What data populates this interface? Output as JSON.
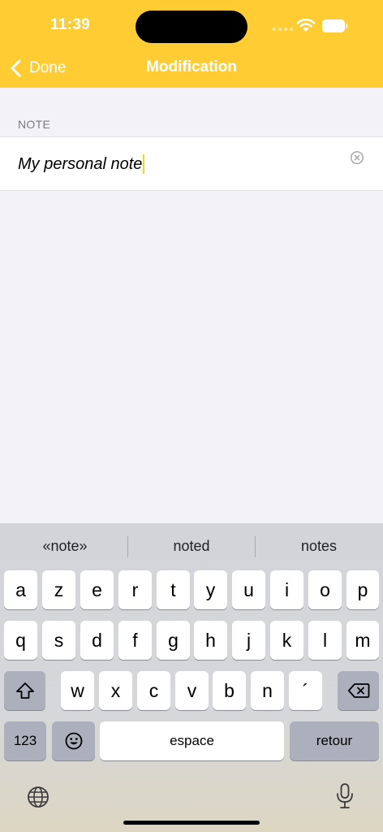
{
  "status": {
    "time": "11:39"
  },
  "nav": {
    "back_label": "Done",
    "title": "Modification"
  },
  "form": {
    "section_label": "NOTE",
    "value": "My personal note"
  },
  "keyboard": {
    "suggestions": [
      "«note»",
      "noted",
      "notes"
    ],
    "row1": [
      "a",
      "z",
      "e",
      "r",
      "t",
      "y",
      "u",
      "i",
      "o",
      "p"
    ],
    "row2": [
      "q",
      "s",
      "d",
      "f",
      "g",
      "h",
      "j",
      "k",
      "l",
      "m"
    ],
    "row3": [
      "w",
      "x",
      "c",
      "v",
      "b",
      "n",
      "´"
    ],
    "numbers_label": "123",
    "space_label": "espace",
    "return_label": "retour"
  },
  "colors": {
    "accent": "#ffcc33",
    "background": "#f2f2f7"
  }
}
